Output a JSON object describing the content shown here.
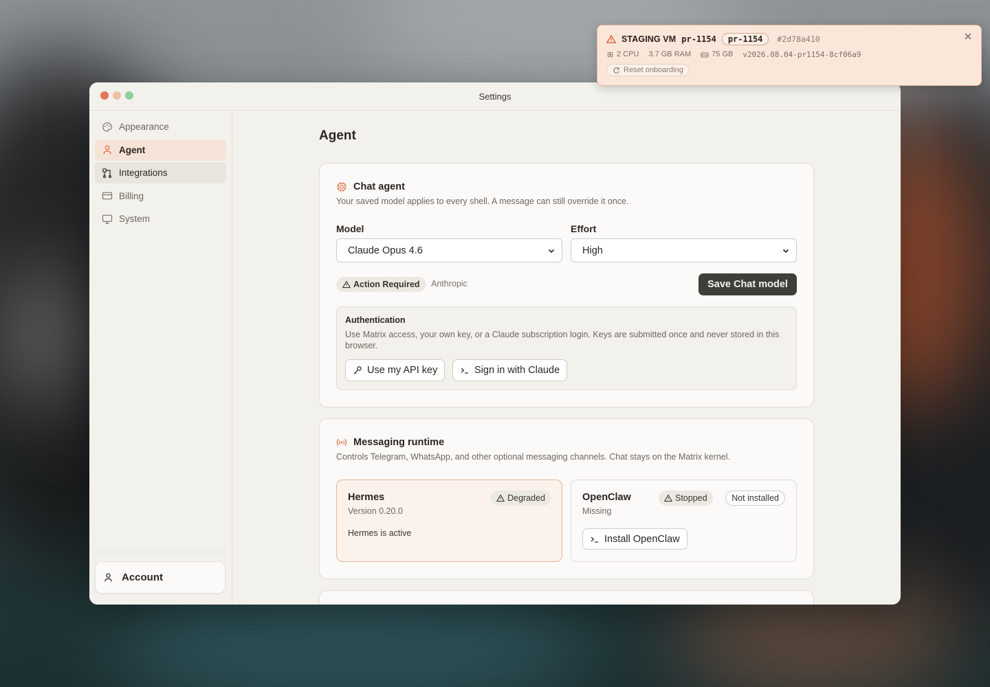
{
  "toast": {
    "title": "STAGING VM",
    "branch": "pr-1154",
    "branch_pill": "pr-1154",
    "commit": "#2d78a410",
    "cpu": "2 CPU",
    "ram": "3.7 GB RAM",
    "disk": "75 GB",
    "version": "v2026.08.04-pr1154-8cf06a9",
    "reset_label": "Reset onboarding"
  },
  "window": {
    "title": "Settings"
  },
  "sidebar": {
    "items": [
      {
        "label": "Appearance",
        "icon": "palette-icon"
      },
      {
        "label": "Agent",
        "icon": "user-icon"
      },
      {
        "label": "Integrations",
        "icon": "integrations-icon"
      },
      {
        "label": "Billing",
        "icon": "card-icon"
      },
      {
        "label": "System",
        "icon": "monitor-icon"
      }
    ],
    "account_label": "Account"
  },
  "page": {
    "title": "Agent"
  },
  "chat_agent": {
    "title": "Chat agent",
    "description": "Your saved model applies to every shell. A message can still override it once.",
    "model_label": "Model",
    "model_value": "Claude Opus 4.6",
    "effort_label": "Effort",
    "effort_value": "High",
    "status_badge": "Action Required",
    "provider": "Anthropic",
    "save_label": "Save Chat model",
    "auth": {
      "title": "Authentication",
      "description": "Use Matrix access, your own key, or a Claude subscription login. Keys are submitted once and never stored in this browser.",
      "api_key_label": "Use my API key",
      "sign_in_label": "Sign in with Claude"
    }
  },
  "messaging": {
    "title": "Messaging runtime",
    "description": "Controls Telegram, WhatsApp, and other optional messaging channels. Chat stays on the Matrix kernel.",
    "hermes": {
      "name": "Hermes",
      "version": "Version 0.20.0",
      "badge": "Degraded",
      "status": "Hermes is active"
    },
    "openclaw": {
      "name": "OpenClaw",
      "sub": "Missing",
      "badge_stopped": "Stopped",
      "badge_not_installed": "Not installed",
      "install_label": "Install OpenClaw"
    }
  },
  "colors": {
    "accent": "#e07048",
    "active_nav_bg": "#f6e3d7",
    "dark_button": "#3d3f39",
    "toast_bg": "#fbe6da"
  }
}
